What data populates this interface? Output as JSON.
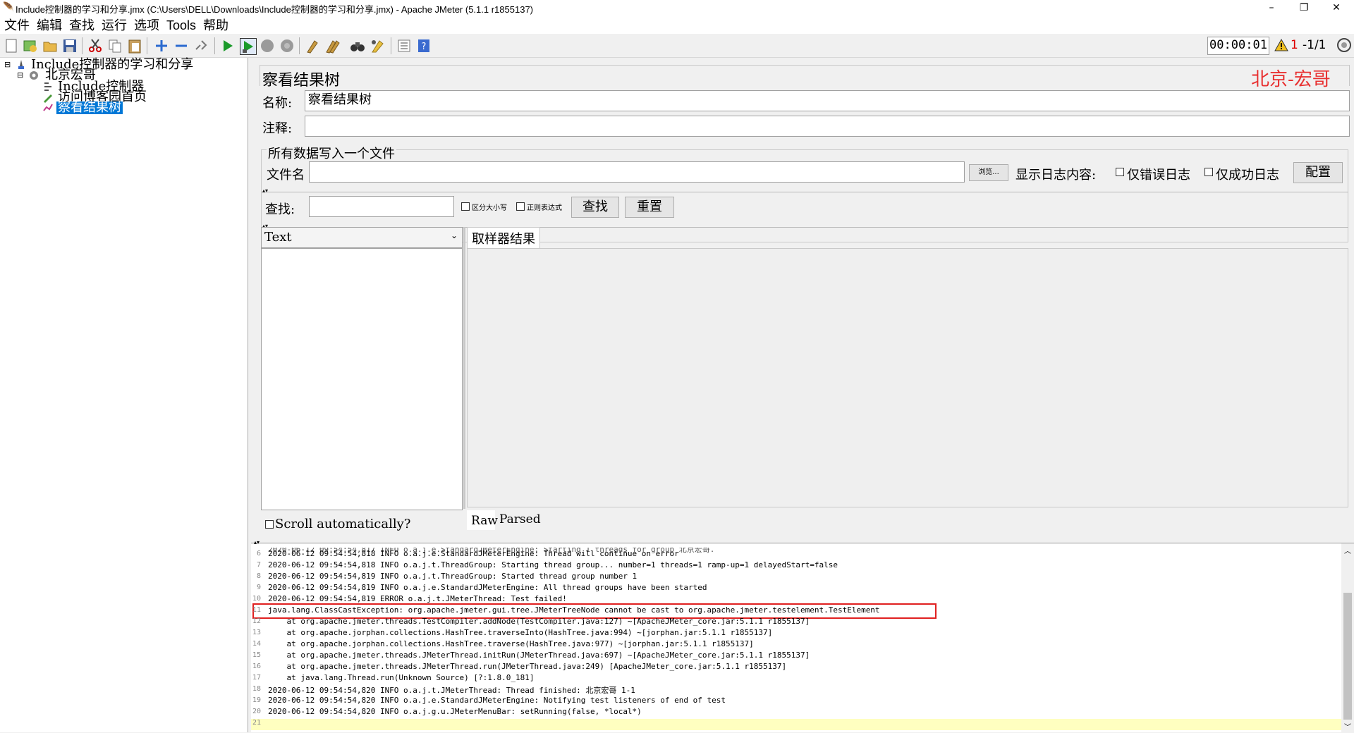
{
  "window": {
    "title": "Include控制器的学习和分享.jmx (C:\\Users\\DELL\\Downloads\\Include控制器的学习和分享.jmx) - Apache JMeter (5.1.1 r1855137)",
    "minimize": "–",
    "maximize": "❐",
    "close": "✕"
  },
  "menu": [
    "文件",
    "编辑",
    "查找",
    "运行",
    "选项",
    "Tools",
    "帮助"
  ],
  "toolbar": {
    "timer": "00:00:01",
    "warnings": "1",
    "threads": "-1/1"
  },
  "tree": {
    "root": "Include控制器的学习和分享",
    "group": "北京宏哥",
    "items": [
      "Include控制器",
      "访问博客园首页",
      "察看结果树"
    ]
  },
  "panel": {
    "title": "察看结果树",
    "watermark": "北京-宏哥",
    "name_label": "名称:",
    "name_value": "察看结果树",
    "comment_label": "注释:",
    "file_section": "所有数据写入一个文件",
    "filename_label": "文件名",
    "browse": "浏览...",
    "log_label": "显示日志内容:",
    "errors_only": "仅错误日志",
    "success_only": "仅成功日志",
    "config": "配置",
    "search_label": "查找:",
    "case_sensitive": "区分大小写",
    "regex": "正则表达式",
    "search_btn": "查找",
    "reset_btn": "重置",
    "renderer": "Text",
    "sampler_tab": "取样器结果",
    "scroll_auto": "Scroll automatically?",
    "raw_tab": "Raw",
    "parsed_tab": "Parsed"
  },
  "log": {
    "lines": [
      {
        "n": "6",
        "t": "2020-06-12 09:54:54,818 INFO o.a.j.e.StandardJMeterEngine: Thread will continue on error"
      },
      {
        "n": "7",
        "t": "2020-06-12 09:54:54,818 INFO o.a.j.t.ThreadGroup: Starting thread group... number=1 threads=1 ramp-up=1 delayedStart=false"
      },
      {
        "n": "8",
        "t": "2020-06-12 09:54:54,819 INFO o.a.j.t.ThreadGroup: Started thread group number 1"
      },
      {
        "n": "9",
        "t": "2020-06-12 09:54:54,819 INFO o.a.j.e.StandardJMeterEngine: All thread groups have been started"
      },
      {
        "n": "10",
        "t": "2020-06-12 09:54:54,819 ERROR o.a.j.t.JMeterThread: Test failed!"
      },
      {
        "n": "11",
        "t": "java.lang.ClassCastException: org.apache.jmeter.gui.tree.JMeterTreeNode cannot be cast to org.apache.jmeter.testelement.TestElement"
      },
      {
        "n": "12",
        "t": "    at org.apache.jmeter.threads.TestCompiler.addNode(TestCompiler.java:127) ~[ApacheJMeter_core.jar:5.1.1 r1855137]"
      },
      {
        "n": "13",
        "t": "    at org.apache.jorphan.collections.HashTree.traverseInto(HashTree.java:994) ~[jorphan.jar:5.1.1 r1855137]"
      },
      {
        "n": "14",
        "t": "    at org.apache.jorphan.collections.HashTree.traverse(HashTree.java:977) ~[jorphan.jar:5.1.1 r1855137]"
      },
      {
        "n": "15",
        "t": "    at org.apache.jmeter.threads.JMeterThread.initRun(JMeterThread.java:697) ~[ApacheJMeter_core.jar:5.1.1 r1855137]"
      },
      {
        "n": "16",
        "t": "    at org.apache.jmeter.threads.JMeterThread.run(JMeterThread.java:249) [ApacheJMeter_core.jar:5.1.1 r1855137]"
      },
      {
        "n": "17",
        "t": "    at java.lang.Thread.run(Unknown Source) [?:1.8.0_181]"
      },
      {
        "n": "18",
        "t": "2020-06-12 09:54:54,820 INFO o.a.j.t.JMeterThread: Thread finished: 北京宏哥 1-1"
      },
      {
        "n": "19",
        "t": "2020-06-12 09:54:54,820 INFO o.a.j.e.StandardJMeterEngine: Notifying test listeners of end of test"
      },
      {
        "n": "20",
        "t": "2020-06-12 09:54:54,820 INFO o.a.j.g.u.JMeterMenuBar: setRunning(false, *local*)"
      },
      {
        "n": "21",
        "t": ""
      }
    ]
  },
  "colors": {
    "highlight_box": "#e02020",
    "watermark": "#e83030",
    "selection": "#0078d7",
    "current_line": "#ffffc0"
  }
}
